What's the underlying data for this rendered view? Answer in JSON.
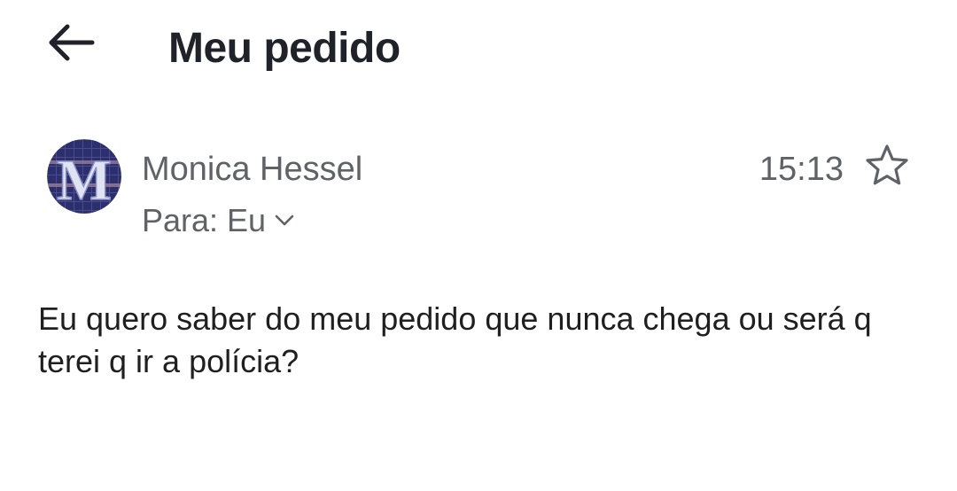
{
  "header": {
    "back_icon": "arrow-left-icon",
    "title": "Meu pedido"
  },
  "message": {
    "avatar_icon": "avatar-letter-m",
    "avatar_letter": "M",
    "sender_name": "Monica Hessel",
    "recipient_label": "Para: Eu",
    "expand_icon": "chevron-down-icon",
    "time": "15:13",
    "star_icon": "star-outline-icon",
    "body": "Eu quero saber do meu pedido que nunca chega ou será q terei q ir a polícia?"
  },
  "colors": {
    "title": "#1f2329",
    "secondary_text": "#5f6368",
    "body_text": "#1f1f1f",
    "avatar_bg": "#2b2f6e"
  }
}
